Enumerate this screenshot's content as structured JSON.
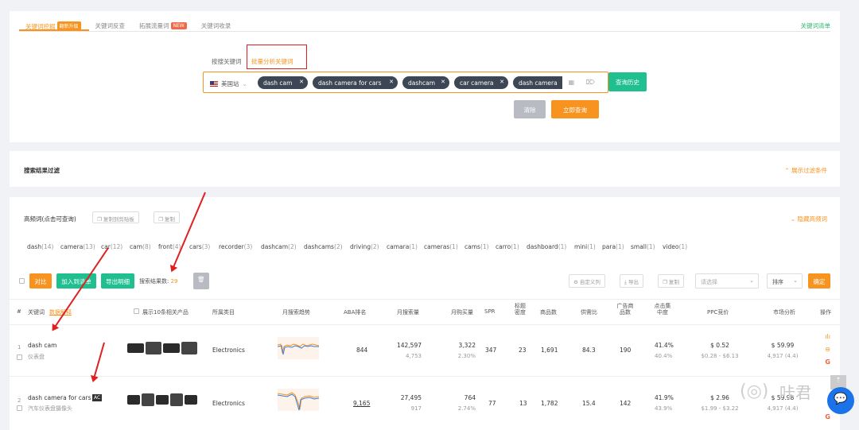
{
  "tabs": [
    {
      "label": "关键词挖掘",
      "badge": "翻新升级"
    },
    {
      "label": "关键词反查",
      "badge": ""
    },
    {
      "label": "拓展流量词",
      "badge": "NEW"
    },
    {
      "label": "关键词收录",
      "badge": ""
    }
  ],
  "keyword_list_link": "关键词清单",
  "search": {
    "mode_single": "按搜关键词",
    "mode_batch": "批量分析关键词",
    "site": "美国站",
    "chips": [
      "dash cam",
      "dash camera for cars",
      "dashcam",
      "car camera",
      "dash camera"
    ],
    "history_label": "查询历史",
    "clear_label": "清除",
    "query_label": "立即查询"
  },
  "filter": {
    "title": "搜索结果过滤",
    "toggle": "展示过滤条件"
  },
  "hot": {
    "title": "高频词(点击可查询)",
    "copy_clip": "复制到剪贴板",
    "copy": "复制",
    "toggle": "隐藏高频词",
    "words": [
      {
        "w": "dash",
        "n": "(14)"
      },
      {
        "w": "camera",
        "n": "(13)"
      },
      {
        "w": "car",
        "n": "(12)"
      },
      {
        "w": "cam",
        "n": "(8)"
      },
      {
        "w": "front",
        "n": "(4)"
      },
      {
        "w": "cars",
        "n": "(3)"
      },
      {
        "w": "recorder",
        "n": "(3)"
      },
      {
        "w": "dashcam",
        "n": "(2)"
      },
      {
        "w": "dashcams",
        "n": "(2)"
      },
      {
        "w": "driving",
        "n": "(2)"
      },
      {
        "w": "camara",
        "n": "(1)"
      },
      {
        "w": "cameras",
        "n": "(1)"
      },
      {
        "w": "cams",
        "n": "(1)"
      },
      {
        "w": "carro",
        "n": "(1)"
      },
      {
        "w": "dashboard",
        "n": "(1)"
      },
      {
        "w": "mini",
        "n": "(1)"
      },
      {
        "w": "para",
        "n": "(1)"
      },
      {
        "w": "small",
        "n": "(1)"
      },
      {
        "w": "video",
        "n": "(1)"
      }
    ]
  },
  "toolbar": {
    "compare": "对比",
    "add_list": "加入到清单",
    "export_detail": "导出明细",
    "result_label": "搜索结果数:",
    "result_count": "29",
    "custom_cols": "自定义列",
    "export": "导出",
    "copy": "复制",
    "select_placeholder": "请选择",
    "sort_label": "排序",
    "confirm": "确定"
  },
  "table": {
    "headers": {
      "idx": "#",
      "keyword": "关键词",
      "data_explain": "数据解释",
      "show_products": "展示10条相关产品",
      "category": "所属类目",
      "trend": "月搜索趋势",
      "aba": "ABA排名",
      "monthly_search": "月搜索量",
      "monthly_buy": "月购买量",
      "spr": "SPR",
      "title_density": "标题密度",
      "product_count": "商品数",
      "supply_ratio": "供需比",
      "ad_count": "广告商品数",
      "click_conc": "点击集中度",
      "ppc": "PPC竞价",
      "market": "市场分析",
      "ops": "操作"
    },
    "rows": [
      {
        "idx": "1",
        "keyword": "dash cam",
        "tag": "",
        "zh": "仪表盘",
        "category": "Electronics",
        "aba": "844",
        "search": "142,597",
        "search_sub": "4,753",
        "buy": "3,322",
        "buy_sub": "2.30%",
        "spr": "347",
        "density": "23",
        "products": "1,691",
        "supply": "84.3",
        "ads": "190",
        "conc": "41.4%",
        "conc_sub": "40.4%",
        "ppc": "$ 0.52",
        "ppc_sub": "$0.28 - $6.13",
        "market": "$ 59.99",
        "market_sub": "4,917 (4.4)"
      },
      {
        "idx": "2",
        "keyword": "dash camera for cars",
        "tag": "AC",
        "zh": "汽车仪表盘摄像头",
        "category": "Electronics",
        "aba": "9,165",
        "search": "27,495",
        "search_sub": "917",
        "buy": "764",
        "buy_sub": "2.74%",
        "spr": "77",
        "density": "13",
        "products": "1,782",
        "supply": "15.4",
        "ads": "142",
        "conc": "41.9%",
        "conc_sub": "43.9%",
        "ppc": "$ 2.96",
        "ppc_sub": "$1.99 - $3.22",
        "market": "$ 59.98",
        "market_sub": "4,917 (4.4)"
      }
    ]
  },
  "watermark": "咔君"
}
